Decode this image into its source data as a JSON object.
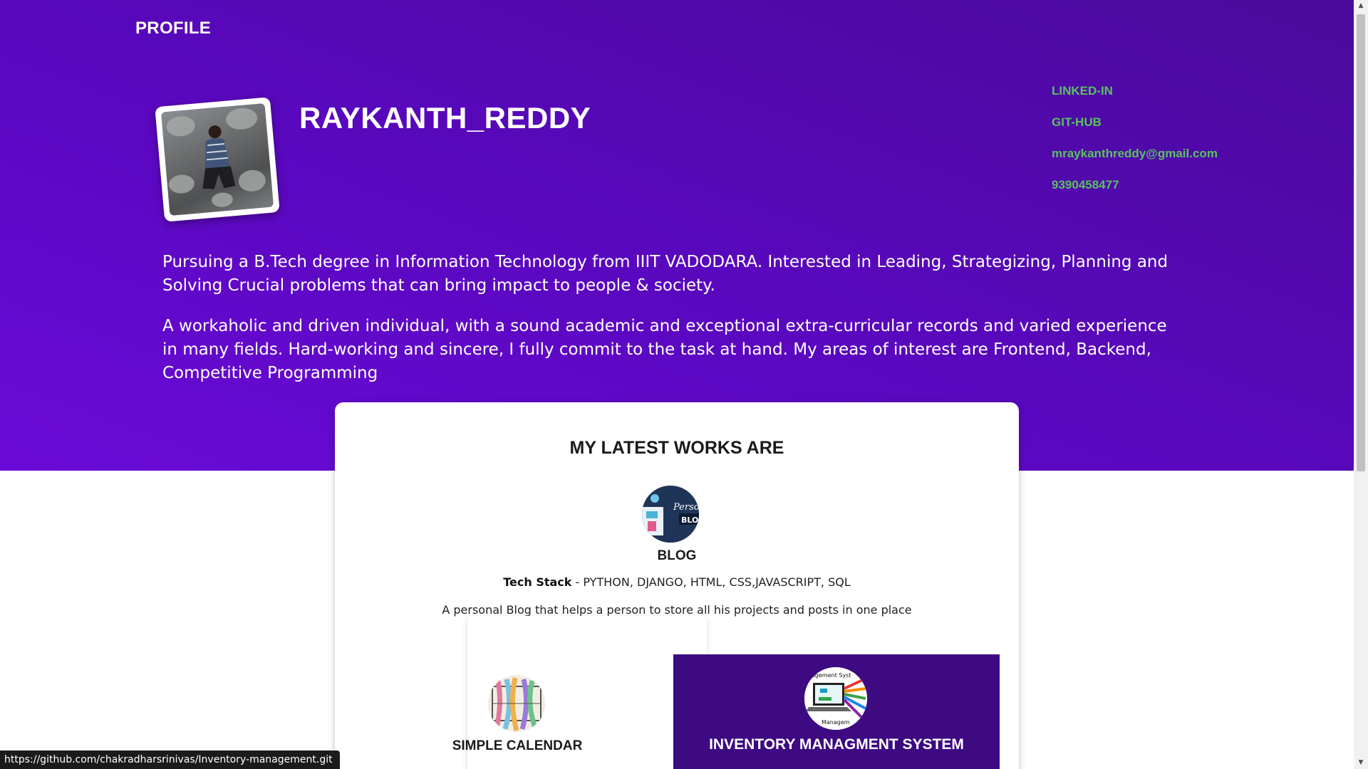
{
  "header": {
    "brand": "PROFILE"
  },
  "profile": {
    "name": "RAYKANTH_REDDY",
    "links": [
      {
        "label": "LINKED-IN"
      },
      {
        "label": "GIT-HUB"
      },
      {
        "label": "mraykanthreddy@gmail.com"
      },
      {
        "label": "9390458477"
      }
    ],
    "bio": [
      "Pursuing a B.Tech degree in Information Technology from IIIT VADODARA. Interested in Leading, Strategizing, Planning and Solving Crucial problems that can bring impact to people & society.",
      "A workaholic and driven individual, with a sound academic and exceptional extra-curricular records and varied experience in many fields. Hard-working and sincere, I fully commit to the task at hand. My areas of interest are Frontend, Backend, Competitive Programming"
    ]
  },
  "works": {
    "title": "MY LATEST WORKS ARE",
    "blog": {
      "title": "BLOG",
      "tech_label": "Tech Stack",
      "tech_value": " - PYTHON, DJANGO, HTML, CSS,JAVASCRIPT, SQL",
      "description": "A personal Blog that helps a person to store all his projects and posts in one place",
      "thumb_text_1": "Perso",
      "thumb_text_2": "BLO"
    },
    "calendar": {
      "title": "SIMPLE CALENDAR"
    },
    "inventory": {
      "title": "INVENTORY MANAGMENT SYSTEM",
      "thumb_text_top": "agement Syst",
      "thumb_text_bottom": "Managem"
    }
  },
  "status_bar": {
    "url": "https://github.com/chakradharsrinivas/Inventory-management.git"
  },
  "colors": {
    "hero_gradient_start": "#4a0a9a",
    "hero_gradient_end": "#6a0ad8",
    "link_green": "#58c25e",
    "inventory_bg": "#3d0a82"
  },
  "icons": {
    "scroll_up": "▲",
    "scroll_down": "▼"
  }
}
